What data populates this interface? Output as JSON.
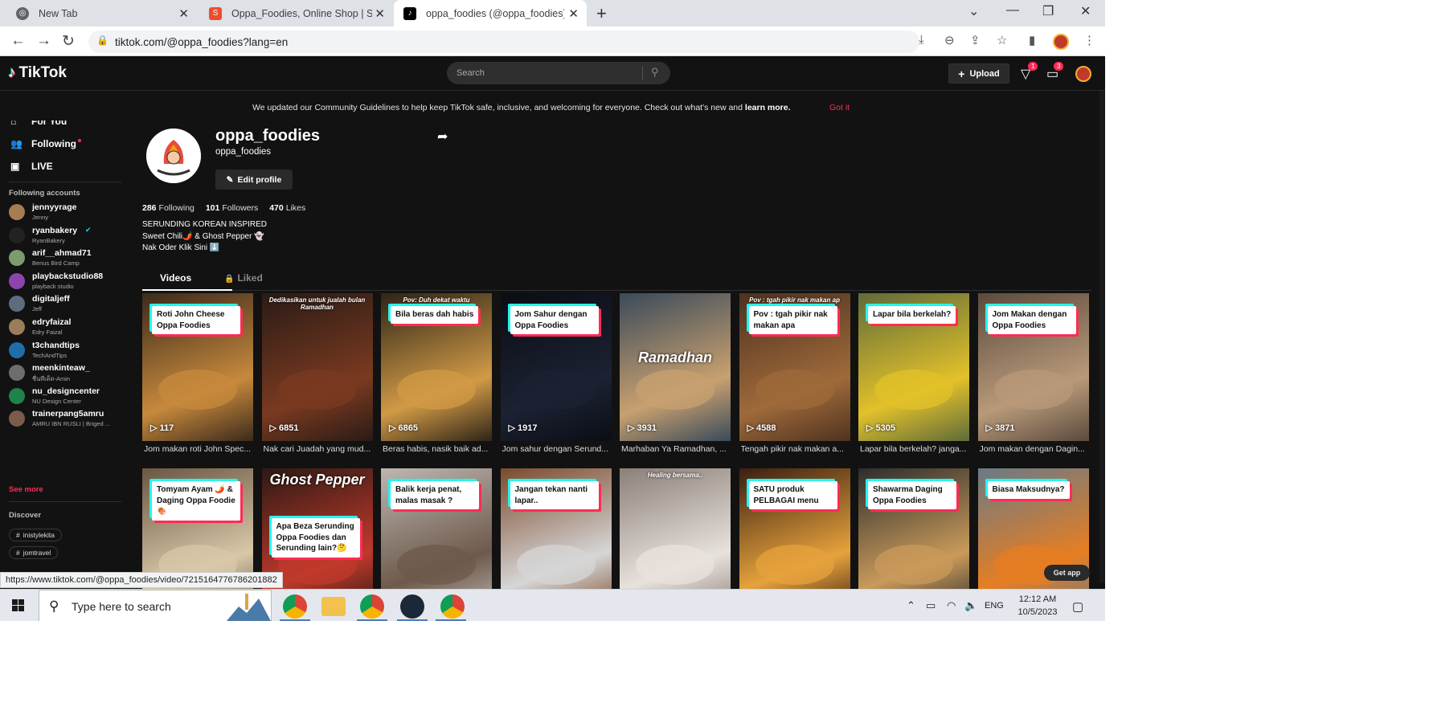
{
  "browser": {
    "tabs": [
      {
        "title": "New Tab",
        "color": "#5f6368"
      },
      {
        "title": "Oppa_Foodies, Online Shop | Shopee",
        "color": "#ee4d2d"
      },
      {
        "title": "oppa_foodies (@oppa_foodies) | TikTok",
        "color": "#000000"
      }
    ],
    "url": "tiktok.com/@oppa_foodies?lang=en"
  },
  "header": {
    "logo": "TikTok",
    "search_placeholder": "Search",
    "upload_label": "Upload",
    "inbox_badge": "1",
    "messages_badge": "3"
  },
  "banner": {
    "message": "We updated our Community Guidelines to help keep TikTok safe, inclusive, and welcoming for everyone. Check out what's new and",
    "link": "learn more.",
    "dismiss": "Got it"
  },
  "sidebar": {
    "nav": [
      {
        "label": "For You",
        "icon": "home-icon"
      },
      {
        "label": "Following",
        "icon": "following-icon"
      },
      {
        "label": "LIVE",
        "icon": "live-icon"
      }
    ],
    "following_heading": "Following accounts",
    "accounts": [
      {
        "username": "jennyyrage",
        "nickname": "Jenny",
        "color": "#a67c52",
        "verified": false
      },
      {
        "username": "ryanbakery",
        "nickname": "RyanBakery",
        "color": "#222222",
        "verified": true
      },
      {
        "username": "arif__ahmad71",
        "nickname": "Benus Bird Camp",
        "color": "#7a9c6e",
        "verified": false
      },
      {
        "username": "playbackstudio88",
        "nickname": "playback studio",
        "color": "#8e44ad",
        "verified": false
      },
      {
        "username": "digitaljeff",
        "nickname": "Jeff",
        "color": "#5d6d7e",
        "verified": false
      },
      {
        "username": "edryfaizal",
        "nickname": "Edry Faizal",
        "color": "#9a7d5a",
        "verified": false
      },
      {
        "username": "t3chandtips",
        "nickname": "TechAndTips",
        "color": "#1e6fa8",
        "verified": false
      },
      {
        "username": "meenkinteaw_",
        "nickname": "ชื่นทีเด็ด-Amin",
        "color": "#6d6d6d",
        "verified": false
      },
      {
        "username": "nu_designcenter",
        "nickname": "NU Design Center",
        "color": "#1e8449",
        "verified": false
      },
      {
        "username": "trainerpang5amru",
        "nickname": "AMRU IBN RUSLI | Briged ...",
        "color": "#7b5c4a",
        "verified": false
      }
    ],
    "see_more": "See more",
    "discover_heading": "Discover",
    "tags": [
      "inistylekita",
      "jomtravel"
    ]
  },
  "profile": {
    "name": "oppa_foodies",
    "handle": "oppa_foodies",
    "edit_label": "Edit profile",
    "following_count": "286",
    "following_label": "Following",
    "followers_count": "101",
    "followers_label": "Followers",
    "likes_count": "470",
    "likes_label": "Likes",
    "bio": [
      "SERUNDING KOREAN INSPIRED",
      "Sweet Chili🌶️ & Ghost Pepper 👻",
      "Nak Oder Klik Sini ⬇️"
    ],
    "tabs": [
      "Videos",
      "Liked"
    ]
  },
  "videos": [
    {
      "caption": "Roti John Cheese Oppa Foodies",
      "plays": "117",
      "desc": "Jom makan roti John Spec...",
      "bg": "#3b2a1c",
      "accent": "#c7893c"
    },
    {
      "caption": "",
      "overlay": "Dedikasikan untuk jualah bulan Ramadhan",
      "plays": "6851",
      "desc": "Nak cari Juadah yang mud...",
      "bg": "#2a1b16",
      "accent": "#7a3a20"
    },
    {
      "caption": "Bila beras dah habis",
      "overlay": "Pov: Duh dekat waktu",
      "plays": "6865",
      "desc": "Beras habis, nasik baik ad...",
      "bg": "#2e2418",
      "accent": "#d19a46"
    },
    {
      "caption": "Jom Sahur dengan Oppa Foodies",
      "plays": "1917",
      "desc": "Jom sahur dengan Serund...",
      "bg": "#0b0d14",
      "accent": "#1c2233"
    },
    {
      "caption": "",
      "overlay": "Ramadhan",
      "plays": "3931",
      "desc": "Marhaban Ya Ramadhan, ...",
      "bg": "#3a4a5a",
      "accent": "#c8a070"
    },
    {
      "caption": "Pov : tgah pikir nak makan apa",
      "overlay": "Pov : tgah pikir nak makan ap",
      "plays": "4588",
      "desc": "Tengah pikir nak makan a...",
      "bg": "#4d3220",
      "accent": "#9f6a3a"
    },
    {
      "caption": "Lapar bila berkelah?",
      "plays": "5305",
      "desc": "Lapar bila berkelah? janga...",
      "bg": "#5f6b3a",
      "accent": "#e2c12a"
    },
    {
      "caption": "Jom Makan dengan Oppa Foodies",
      "plays": "3871",
      "desc": "Jom makan dengan Dagin...",
      "bg": "#5b4a3d",
      "accent": "#b89a7a"
    },
    {
      "caption": "Tomyam Ayam 🌶️ & Daging Oppa Foodie🍖",
      "plays": "",
      "desc": "",
      "bg": "#6a5642",
      "accent": "#d8c7a8"
    },
    {
      "caption": "Apa Beza Serunding Oppa Foodies dan Serunding lain?🤔",
      "overlay": "Ghost Pepper",
      "plays": "",
      "desc": "",
      "bg": "#2c1a14",
      "accent": "#c0392b"
    },
    {
      "caption": "Balik kerja penat, malas masak ?",
      "plays": "",
      "desc": "",
      "bg": "#bdb6b0",
      "accent": "#6e5a4c"
    },
    {
      "caption": "Jangan tekan nanti lapar..",
      "plays": "",
      "desc": "",
      "bg": "#7b4a2c",
      "accent": "#d6d6d6"
    },
    {
      "caption": "",
      "overlay": "Healing bersama..",
      "plays": "",
      "desc": "",
      "bg": "#8b7f79",
      "accent": "#e8e2dc"
    },
    {
      "caption": "SATU produk PELBAGAI menu",
      "plays": "",
      "desc": "",
      "bg": "#3a1f12",
      "accent": "#e6a23c"
    },
    {
      "caption": "Shawarma Daging Oppa Foodies",
      "plays": "",
      "desc": "",
      "bg": "#2d2d2d",
      "accent": "#c99a5a"
    },
    {
      "caption": "Biasa Maksudnya?",
      "plays": "",
      "desc": "",
      "bg": "#6a7a86",
      "accent": "#e67e22"
    }
  ],
  "get_app": "Get app",
  "status_url": "https://www.tiktok.com/@oppa_foodies/video/7215164776786201882",
  "taskbar": {
    "search_placeholder": "Type here to search",
    "lang": "ENG",
    "time": "12:12 AM",
    "date": "10/5/2023"
  }
}
